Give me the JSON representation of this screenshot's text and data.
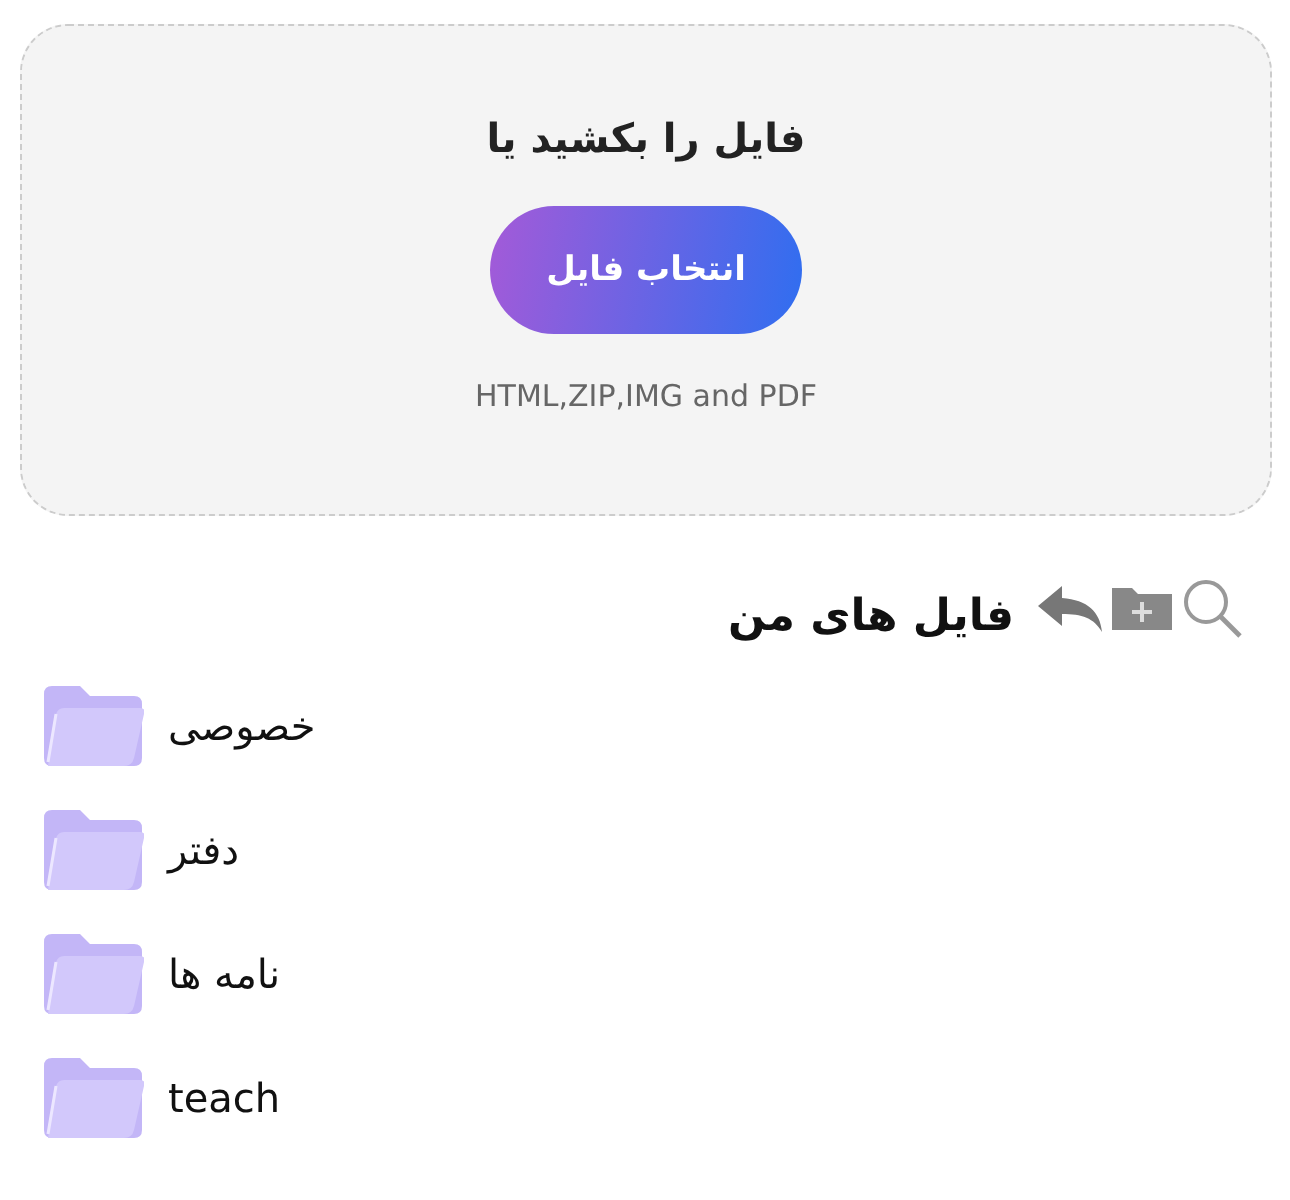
{
  "upload": {
    "title": "فایل را بکشید یا",
    "button": "انتخاب فایل",
    "formats": "HTML,ZIP,IMG and PDF"
  },
  "files": {
    "title": "فایل های من",
    "folders": [
      {
        "name": "خصوصی"
      },
      {
        "name": "دفتر"
      },
      {
        "name": "نامه ها"
      },
      {
        "name": "teach"
      }
    ]
  }
}
